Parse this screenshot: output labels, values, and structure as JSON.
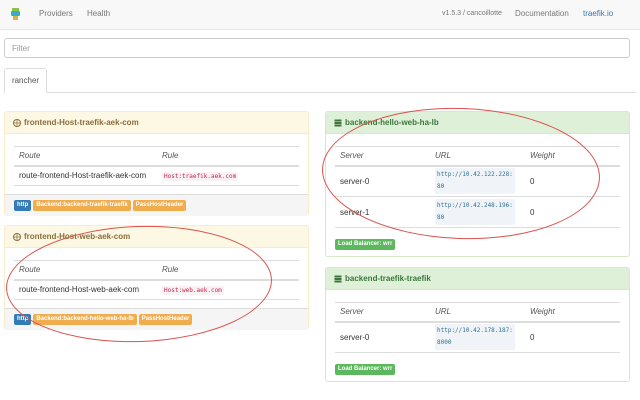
{
  "navbar": {
    "links": [
      "Providers",
      "Health"
    ],
    "version": "v1.5.3 / cancoillotte",
    "documentation": "Documentation",
    "brand": "traefik.io"
  },
  "filter": {
    "placeholder": "Filter",
    "value": ""
  },
  "tabs": [
    {
      "label": "rancher",
      "active": true
    }
  ],
  "frontends": [
    {
      "title": "frontend-Host-traefik-aek-com",
      "columns": [
        "Route",
        "Rule"
      ],
      "rows": [
        {
          "route": "route-frontend-Host-traefik-aek-com",
          "rule": "Host:traefik.aek.com"
        }
      ],
      "badges": [
        "http",
        "Backend:backend-traefik-traefik",
        "PassHostHeader"
      ]
    },
    {
      "title": "frontend-Host-web-aek-com",
      "columns": [
        "Route",
        "Rule"
      ],
      "rows": [
        {
          "route": "route-frontend-Host-web-aek-com",
          "rule": "Host:web.aek.com"
        }
      ],
      "badges": [
        "http",
        "Backend:backend-hello-web-ha-lb",
        "PassHostHeader"
      ]
    }
  ],
  "backends": [
    {
      "title": "backend-hello-web-ha-lb",
      "columns": [
        "Server",
        "URL",
        "Weight"
      ],
      "rows": [
        {
          "server": "server-0",
          "url_line1": "http://10.42.122.228:",
          "url_line2": "80",
          "weight": "0"
        },
        {
          "server": "server-1",
          "url_line1": "http://10.42.248.196:",
          "url_line2": "80",
          "weight": "0"
        }
      ],
      "load_balancer": "Load Balancer: wrr"
    },
    {
      "title": "backend-traefik-traefik",
      "columns": [
        "Server",
        "URL",
        "Weight"
      ],
      "rows": [
        {
          "server": "server-0",
          "url_line1": "http://10.42.178.187:",
          "url_line2": "8000",
          "weight": "0"
        }
      ],
      "load_balancer": "Load Balancer: wrr"
    }
  ],
  "colors": {
    "frontend_heading": "#fcf8e3",
    "backend_heading": "#dff0d8",
    "badge_http": "#337ab7",
    "badge_warning": "#f0ad4e",
    "badge_success": "#5cb85c",
    "annotation": "#d9534f"
  },
  "icons": {
    "frontend": "globe-icon",
    "backend": "server-stack-icon",
    "logo": "traefik-gopher-logo"
  }
}
